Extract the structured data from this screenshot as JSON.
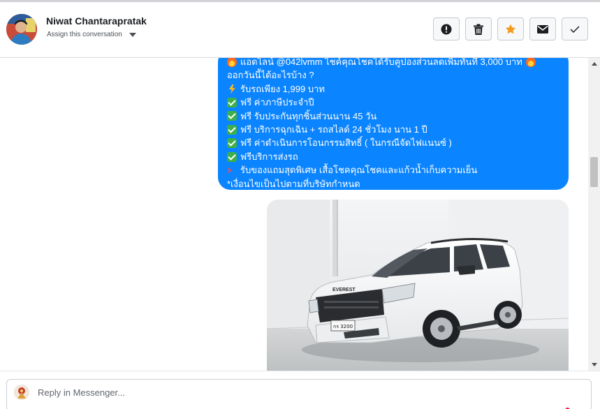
{
  "header": {
    "contact_name": "Niwat Chantarapratak",
    "assign_label": "Assign this conversation",
    "actions": [
      {
        "name": "mark-spam",
        "icon": "exclamation-circle-icon"
      },
      {
        "name": "delete",
        "icon": "trash-icon"
      },
      {
        "name": "star",
        "icon": "star-icon",
        "active": true
      },
      {
        "name": "mark-unread",
        "icon": "envelope-icon"
      },
      {
        "name": "mark-done",
        "icon": "checkmark-icon"
      }
    ]
  },
  "message": {
    "lines": [
      "แอดไลน์ @042lvmm ไชค์คุณโชคได้รับคูปองส่วนลดเพิ่มทันที 3,000 บาท",
      "ออกวันนี้ได้อะไรบ้าง ?",
      "รับรถเพียง 1,999 บาท",
      "ฟรี ค่าภาษีประจำปี",
      "ฟรี รับประกันทุกชิ้นส่วนนาน 45 วัน",
      "ฟรี บริการฉุกเฉิน + รถสไลด์ 24 ชั่วโมง นาน 1 ปี",
      "ฟรี ค่าดำเนินการโอนกรรมสิทธิ์ ( ในกรณีจัดไฟแนนซ์ )",
      "ฟรีบริการส่งรถ",
      "รับของแถมสุดพิเศษ เสื้อโชคคุณโชคและแก้วน้ำเก็บความเย็น",
      "*เงื่อนไขเป็นไปตามที่บริษัทกำหนด"
    ],
    "bubble_color": "#0a84ff"
  },
  "photo": {
    "car_badge": "EVEREST",
    "plate": "กร 3200"
  },
  "composer": {
    "placeholder": "Reply in Messenger..."
  },
  "colors": {
    "star_active": "#f29a1b",
    "accent": "#0a84ff"
  }
}
